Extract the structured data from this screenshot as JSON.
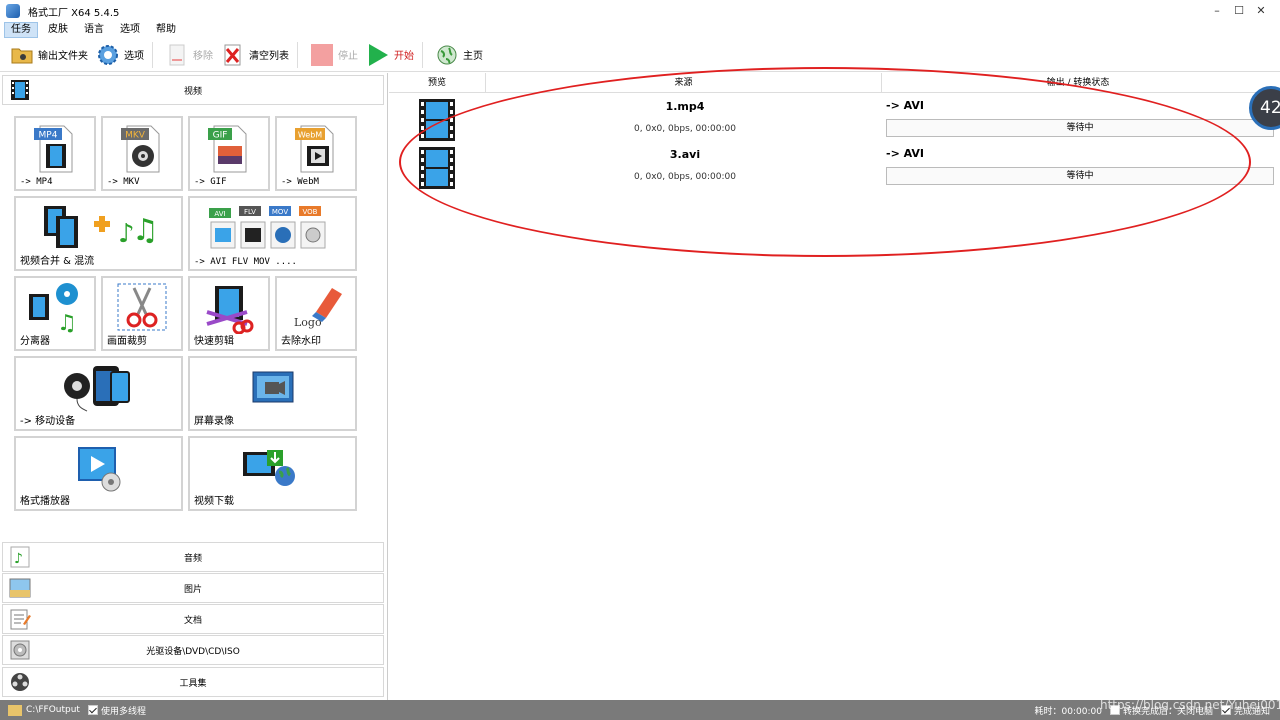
{
  "window": {
    "title": "格式工厂 X64 5.4.5",
    "buttons": [
      "–",
      "☐",
      "✕"
    ]
  },
  "menu": [
    "任务",
    "皮肤",
    "语言",
    "选项",
    "帮助"
  ],
  "toolbar": {
    "output_folder": "输出文件夹",
    "options": "选项",
    "remove": "移除",
    "clear_list": "清空列表",
    "stop": "停止",
    "start": "开始",
    "home": "主页"
  },
  "categories": {
    "video": "视频",
    "audio": "音频",
    "image": "图片",
    "document": "文档",
    "disc": "光驱设备\\DVD\\CD\\ISO",
    "tools": "工具集"
  },
  "tiles": {
    "mp4": {
      "label": "-> MP4",
      "badge": "MP4"
    },
    "mkv": {
      "label": "-> MKV",
      "badge": "MKV"
    },
    "gif": {
      "label": "-> GIF",
      "badge": "GIF"
    },
    "webm": {
      "label": "-> WebM",
      "badge": "WebM"
    },
    "merge": {
      "label": "视频合并 & 混流"
    },
    "multi": {
      "label": "-> AVI FLV MOV ....",
      "badges": [
        "AVI",
        "FLV",
        "MOV",
        "VOB"
      ]
    },
    "splitter": {
      "label": "分离器"
    },
    "crop": {
      "label": "画面裁剪"
    },
    "quickcut": {
      "label": "快速剪辑"
    },
    "watermark": {
      "label": "去除水印",
      "logo_text": "Logo"
    },
    "mobile": {
      "label": "-> 移动设备"
    },
    "screen": {
      "label": "屏幕录像"
    },
    "player": {
      "label": "格式播放器"
    },
    "download": {
      "label": "视频下载"
    }
  },
  "table": {
    "headers": [
      "预览",
      "来源",
      "输出 / 转换状态"
    ],
    "rows": [
      {
        "file": "1.mp4",
        "meta": "0, 0x0, 0bps, 00:00:00",
        "output": "-> AVI",
        "status": "等待中"
      },
      {
        "file": "3.avi",
        "meta": "0, 0x0, 0bps, 00:00:00",
        "output": "-> AVI",
        "status": "等待中"
      }
    ]
  },
  "badge_number": "42",
  "statusbar": {
    "folder": "C:\\FFOutput",
    "multithread": "使用多线程",
    "elapsed": "耗时：00:00:00",
    "after_done": "转换完成后：关闭电脑",
    "notify": "完成通知"
  },
  "watermark_text": "https://blog.csdn.net/Yuhei001",
  "colors": {
    "accent_red": "#e02020",
    "start_green": "#22b14c",
    "statusbar": "#7a7a7a"
  }
}
